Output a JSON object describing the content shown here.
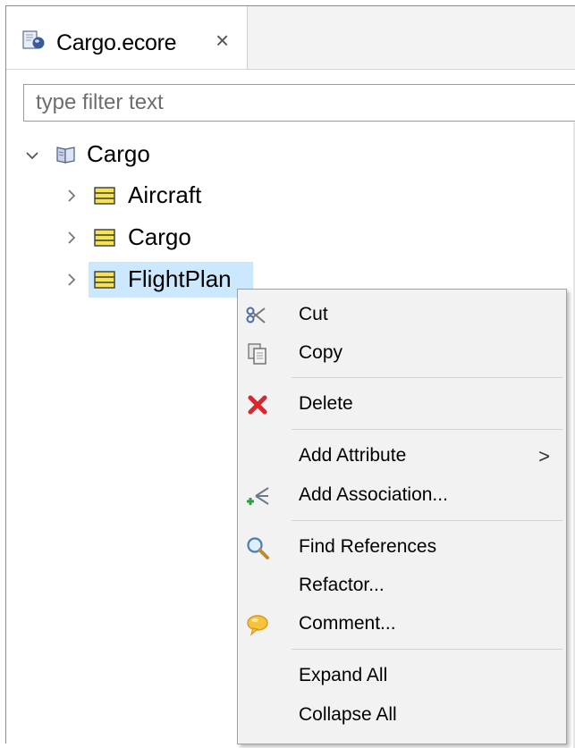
{
  "tab": {
    "title": "Cargo.ecore",
    "close_glyph": "×",
    "icon": "ecore-file-icon"
  },
  "filter": {
    "placeholder": "type filter text",
    "value": ""
  },
  "tree": {
    "root": {
      "label": "Cargo",
      "icon": "package-icon",
      "expanded": true
    },
    "children": [
      {
        "label": "Aircraft",
        "icon": "eclass-icon",
        "expanded": false
      },
      {
        "label": "Cargo",
        "icon": "eclass-icon",
        "expanded": false
      },
      {
        "label": "FlightPlan",
        "icon": "eclass-icon",
        "expanded": false,
        "selected": true
      }
    ]
  },
  "context_menu": {
    "items": [
      {
        "label": "Cut",
        "icon": "scissors-icon"
      },
      {
        "label": "Copy",
        "icon": "copy-icon"
      },
      {
        "label": "Delete",
        "icon": "delete-icon"
      },
      {
        "label": "Add Attribute",
        "icon": "",
        "submenu": true,
        "submenu_glyph": ">"
      },
      {
        "label": "Add Association...",
        "icon": "add-association-icon"
      },
      {
        "label": "Find References",
        "icon": "magnifier-icon"
      },
      {
        "label": "Refactor...",
        "icon": ""
      },
      {
        "label": "Comment...",
        "icon": "comment-icon"
      },
      {
        "label": "Expand All",
        "icon": ""
      },
      {
        "label": "Collapse All",
        "icon": ""
      }
    ]
  },
  "colors": {
    "selection": "#cce8ff",
    "menu_background": "#f2f2f2",
    "class_icon_fill": "#f5e44f",
    "delete_red": "#d9262c"
  }
}
